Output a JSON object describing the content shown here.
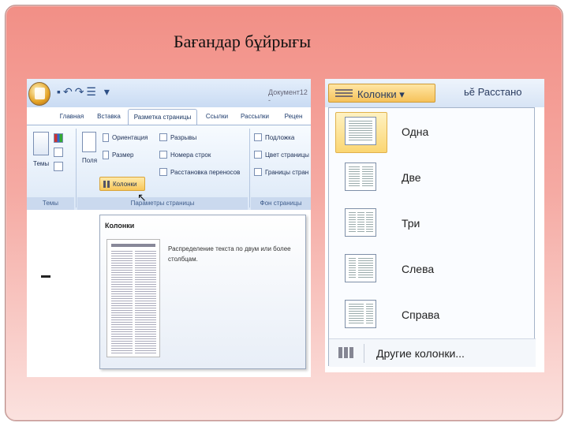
{
  "slide": {
    "title": "Бағандар бұйрығы"
  },
  "word_ribbon": {
    "doc_title": "Документ12 -",
    "tabs": [
      "Главная",
      "Вставка",
      "Разметка страницы",
      "Ссылки",
      "Рассылки",
      "Рецен"
    ],
    "active_tab": "Разметка страницы",
    "themes_group": {
      "label": "Темы",
      "button": "Темы"
    },
    "page_setup": {
      "fields": "Поля",
      "orientation": "Ориентация",
      "size": "Размер",
      "columns": "Колонки",
      "breaks": "Разрывы",
      "line_numbers": "Номера строк",
      "hyphenation": "Расстановка переносов",
      "label": "Параметры страницы"
    },
    "background": {
      "watermark": "Подложка",
      "page_color": "Цвет страницы",
      "page_borders": "Границы стран",
      "label": "Фон страницы"
    }
  },
  "tooltip": {
    "title": "Колонки",
    "description": "Распределение текста по двум или более столбцам."
  },
  "columns_menu": {
    "button_label": "Колонки",
    "next_button": "Расстано",
    "items": [
      {
        "label": "Одна",
        "selected": true
      },
      {
        "label": "Две"
      },
      {
        "label": "Три"
      },
      {
        "label": "Слева"
      },
      {
        "label": "Справа"
      }
    ],
    "more": "Другие колонки...",
    "accent": "#f8c75a"
  }
}
